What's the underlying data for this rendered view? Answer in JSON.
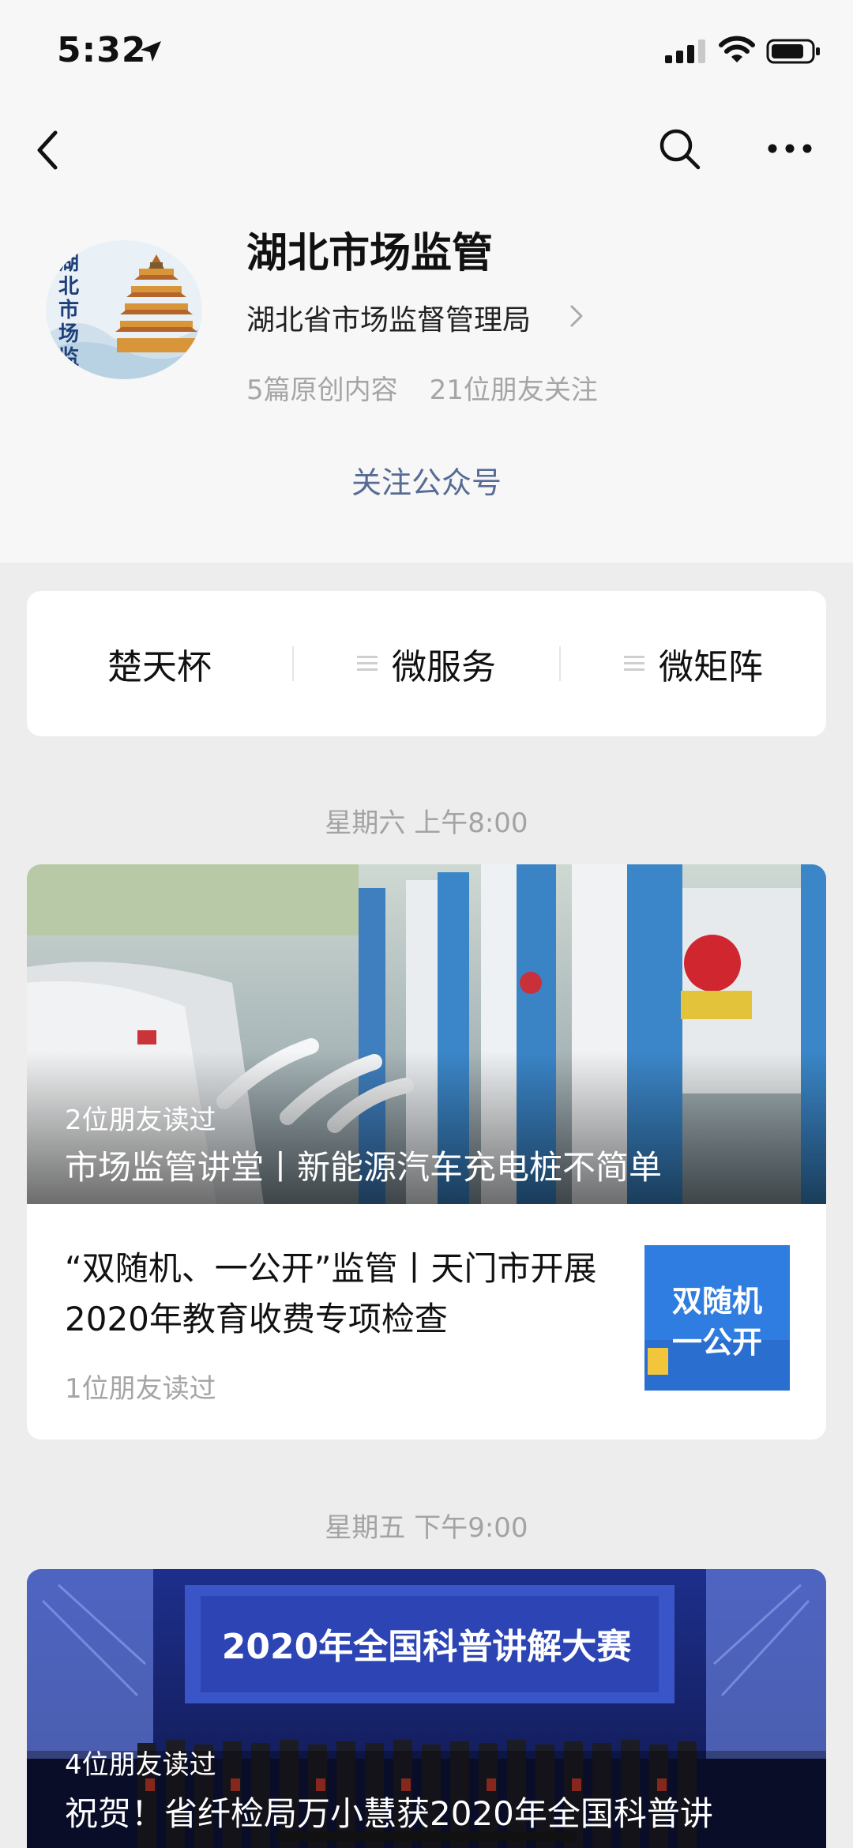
{
  "status_bar": {
    "time": "5:32"
  },
  "nav": {
    "back_icon": "chevron-left-icon",
    "search_icon": "search-icon",
    "more_icon": "more-icon"
  },
  "account": {
    "avatar_text": "湖北市场监管",
    "name": "湖北市场监管",
    "organization": "湖北省市场监督管理局",
    "original_count": "5篇原创内容",
    "friends_following": "21位朋友关注",
    "follow_label": "关注公众号"
  },
  "menu": {
    "items": [
      {
        "label": "楚天杯"
      },
      {
        "label": "微服务"
      },
      {
        "label": "微矩阵"
      }
    ]
  },
  "feed": [
    {
      "date": "星期六 上午8:00",
      "main": {
        "readers": "2位朋友读过",
        "title": "市场监管讲堂丨新能源汽车充电桩不简单"
      },
      "sub": {
        "title": "“双随机、一公开”监管丨天门市开展2020年教育收费专项检查",
        "readers": "1位朋友读过",
        "thumb_text_1": "双随机",
        "thumb_text_2": "一公开"
      }
    },
    {
      "date": "星期五 下午9:00",
      "main": {
        "readers": "4位朋友读过",
        "title": "祝贺！省纤检局万小慧获2020年全国科普讲",
        "banner_text": "2020年全国科普讲解大赛"
      }
    }
  ],
  "colors": {
    "link": "#576b95",
    "background": "#ededed",
    "header_bg": "#f7f7f7",
    "muted_text": "#a5a5a5"
  }
}
